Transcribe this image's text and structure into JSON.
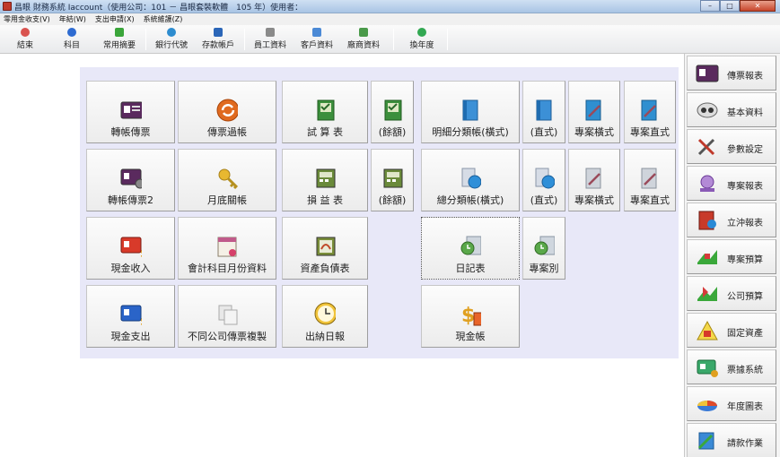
{
  "window": {
    "title": "昌眼 財務系統 Iaccount（使用公司：101 － 昌眼套裝軟體　105 年）使用者：",
    "controls": [
      "–",
      "□",
      "✕"
    ]
  },
  "menu": [
    "零用金收支(V)",
    "年結(W)",
    "支出申請(X)",
    "系統維護(Z)"
  ],
  "toolbar": [
    {
      "label": "結束",
      "icon": "exit-icon",
      "color": "#d9534f"
    },
    {
      "label": "科目",
      "icon": "account-icon",
      "color": "#2e6bd1"
    },
    {
      "label": "常用摘要",
      "icon": "summary-icon",
      "color": "#3aa53a"
    },
    {
      "label": "銀行代號",
      "icon": "bank-icon",
      "color": "#2d8ccf"
    },
    {
      "label": "存款帳戶",
      "icon": "deposit-icon",
      "color": "#2b66b8"
    },
    {
      "label": "員工資料",
      "icon": "employee-icon",
      "color": "#8a8a8a"
    },
    {
      "label": "客戶資料",
      "icon": "customer-icon",
      "color": "#4c8ad6"
    },
    {
      "label": "廠商資料",
      "icon": "vendor-icon",
      "color": "#4a9a4a"
    },
    {
      "label": "換年度",
      "icon": "change-year-icon",
      "color": "#32a852"
    }
  ],
  "grid": {
    "voucher": "轉帳傳票",
    "posting": "傳票過帳",
    "trial_balance": "試 算 表",
    "trial_balance_balance": "(餘額)",
    "ledger_detail_h": "明細分類帳(橫式)",
    "ledger_detail_v": "(直式)",
    "project_h_1": "專案橫式",
    "project_v_1": "專案直式",
    "voucher2": "轉帳傳票2",
    "month_close": "月底關帳",
    "income_statement": "損 益 表",
    "income_balance": "(餘額)",
    "general_ledger_h": "總分類帳(橫式)",
    "general_ledger_v": "(直式)",
    "project_h_2": "專案橫式",
    "project_v_2": "專案直式",
    "cash_income": "現金收入",
    "monthly_subjects": "會計科目月份資料",
    "balance_sheet": "資產負債表",
    "journal": "日記表",
    "by_project": "專案別",
    "cash_expense": "現金支出",
    "copy_vouchers": "不同公司傳票複製",
    "cash_daily": "出納日報",
    "cash_ledger": "現金帳"
  },
  "sidebar": [
    {
      "label": "傳票報表",
      "icon": "voucher-report-icon"
    },
    {
      "label": "基本資料",
      "icon": "basic-data-icon"
    },
    {
      "label": "參數設定",
      "icon": "settings-icon"
    },
    {
      "label": "專案報表",
      "icon": "project-report-icon"
    },
    {
      "label": "立沖報表",
      "icon": "offset-report-icon"
    },
    {
      "label": "專案預算",
      "icon": "project-budget-icon"
    },
    {
      "label": "公司預算",
      "icon": "company-budget-icon"
    },
    {
      "label": "固定資產",
      "icon": "fixed-asset-icon"
    },
    {
      "label": "票據系統",
      "icon": "bill-system-icon"
    },
    {
      "label": "年度圖表",
      "icon": "annual-chart-icon"
    },
    {
      "label": "請款作業",
      "icon": "request-payment-icon"
    }
  ]
}
